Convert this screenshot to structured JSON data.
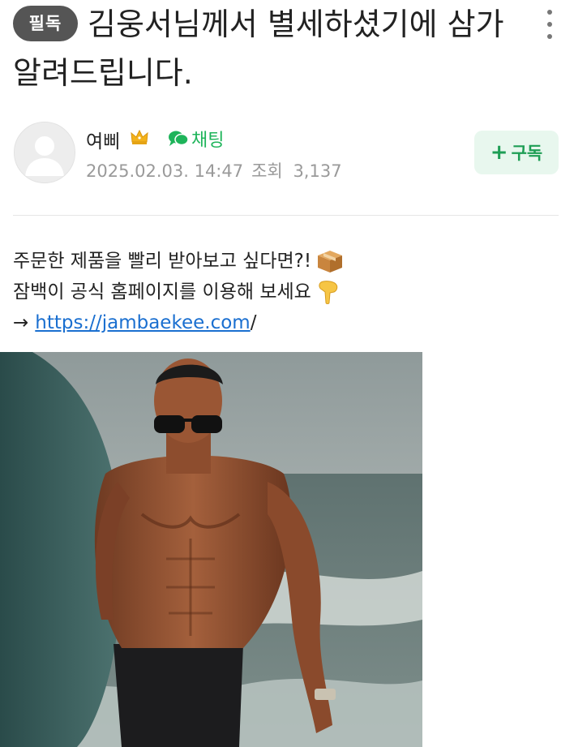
{
  "post": {
    "badge": "필독",
    "title": "김웅서님께서 별세하셨기에 삼가 알려드립니다."
  },
  "author": {
    "name": "여삐",
    "chat_label": "채팅",
    "date": "2025.02.03. 14:47",
    "views_label": "조회",
    "views": "3,137"
  },
  "subscribe": {
    "label": "구독"
  },
  "content": {
    "line1": "주문한 제품을 빨리 받아보고 싶다면?!",
    "line2": "잠백이 공식 홈페이지를 이용해 보세요",
    "arrow": "→",
    "link_text": "https://jambaekee.com",
    "link_suffix": "/"
  },
  "icons": {
    "more": "more-vertical-icon",
    "crown": "crown-icon",
    "chat": "chat-bubble-icon",
    "box_emoji": "package-emoji",
    "hand_emoji": "pointing-down-emoji"
  },
  "colors": {
    "accent_green": "#1eb45a",
    "subscribe_bg": "#e8f7ee",
    "badge_bg": "#555555",
    "link": "#1a6fd0"
  }
}
